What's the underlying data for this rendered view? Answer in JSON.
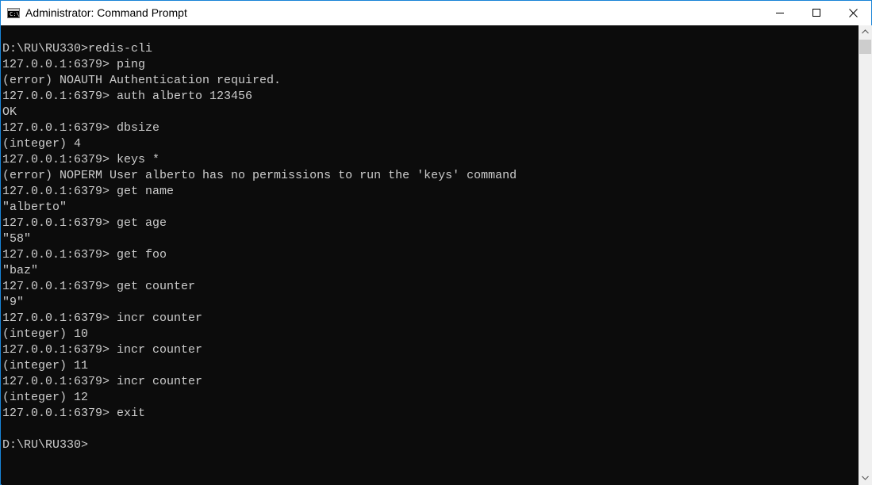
{
  "window": {
    "title": "Administrator: Command Prompt",
    "icon": "cmd-icon",
    "icon_text": "C:\\."
  },
  "controls": {
    "minimize": "minimize-icon",
    "maximize": "maximize-icon",
    "close": "close-icon"
  },
  "console": {
    "lines": [
      "D:\\RU\\RU330>redis-cli",
      "127.0.0.1:6379> ping",
      "(error) NOAUTH Authentication required.",
      "127.0.0.1:6379> auth alberto 123456",
      "OK",
      "127.0.0.1:6379> dbsize",
      "(integer) 4",
      "127.0.0.1:6379> keys *",
      "(error) NOPERM User alberto has no permissions to run the 'keys' command",
      "127.0.0.1:6379> get name",
      "\"alberto\"",
      "127.0.0.1:6379> get age",
      "\"58\"",
      "127.0.0.1:6379> get foo",
      "\"baz\"",
      "127.0.0.1:6379> get counter",
      "\"9\"",
      "127.0.0.1:6379> incr counter",
      "(integer) 10",
      "127.0.0.1:6379> incr counter",
      "(integer) 11",
      "127.0.0.1:6379> incr counter",
      "(integer) 12",
      "127.0.0.1:6379> exit",
      "",
      "D:\\RU\\RU330>"
    ]
  },
  "colors": {
    "background": "#0c0c0c",
    "text": "#cccccc",
    "border": "#1883d7"
  }
}
